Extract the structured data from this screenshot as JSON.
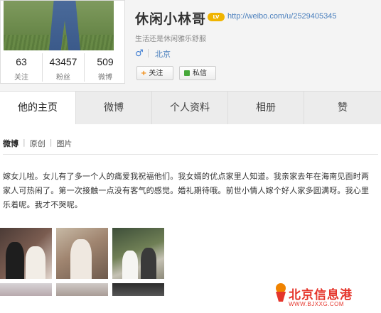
{
  "profile": {
    "name": "休闲小林哥",
    "badge": "LV",
    "url": "http://weibo.com/u/2529405345",
    "tagline": "生活还是休闲雅乐舒服",
    "gender_icon": "male-icon",
    "location": "北京",
    "follow_label": "关注",
    "message_label": "私信"
  },
  "stats": [
    {
      "value": "63",
      "label": "关注"
    },
    {
      "value": "43457",
      "label": "粉丝"
    },
    {
      "value": "509",
      "label": "微博"
    }
  ],
  "tabs": [
    "他的主页",
    "微博",
    "个人资料",
    "相册",
    "赞"
  ],
  "subtabs": [
    "微博",
    "原创",
    "图片"
  ],
  "post": {
    "text": "嫁女儿啦。女儿有了多一个人的痛爱我祝福他们。我女婿的优点家里人知道。我亲家去年在海南见面时两家人可热闹了。第一次接触一点没有客气的感觉。婚礼期待哦。前世小情人嫁个好人家多圆满呀。我心里乐着呢。我才不哭呢。"
  },
  "watermark": {
    "name": "北京信息港",
    "url": "WWW.BJXXG.COM"
  },
  "colors": {
    "link": "#4a7fbd",
    "accent": "#f08300",
    "watermark": "#e5352b"
  }
}
